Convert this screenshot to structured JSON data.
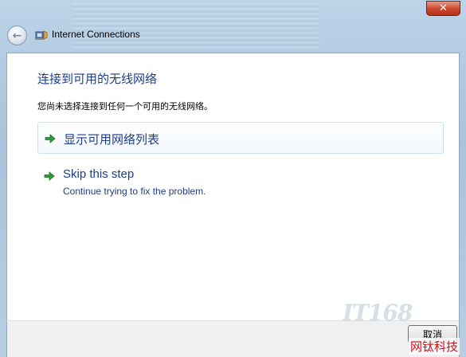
{
  "window": {
    "title": "Internet Connections",
    "close_label": "✕",
    "back_label": "←"
  },
  "content": {
    "heading": "连接到可用的无线网络",
    "subtext": "您尚未选择连接到任何一个可用的无线网络。",
    "option_show_networks": "显示可用网络列表",
    "option_skip_title": "Skip this step",
    "option_skip_desc": "Continue trying to fix the problem."
  },
  "footer": {
    "cancel_label": "取消"
  },
  "watermark": {
    "logo": "IT168",
    "text": "网钛科技"
  },
  "colors": {
    "link_blue": "#1e3d8b",
    "arrow_green": "#2f9a37"
  }
}
